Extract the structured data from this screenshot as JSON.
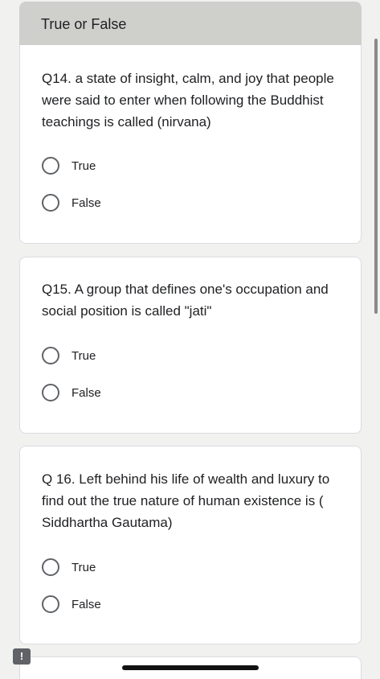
{
  "section": {
    "title": "True or False"
  },
  "questions": [
    {
      "text": "Q14. a state of insight, calm, and joy that people were said to enter when following the Buddhist teachings is called (nirvana)",
      "options": [
        "True",
        "False"
      ]
    },
    {
      "text": "Q15. A group that defines one's occupation and social position is called \"jati\"",
      "options": [
        "True",
        "False"
      ]
    },
    {
      "text": "Q 16. Left behind his life of wealth and luxury to find out the true nature of human existence is ( Siddhartha Gautama)",
      "options": [
        "True",
        "False"
      ]
    }
  ],
  "feedback": {
    "icon": "feedback-icon",
    "glyph": "!"
  }
}
